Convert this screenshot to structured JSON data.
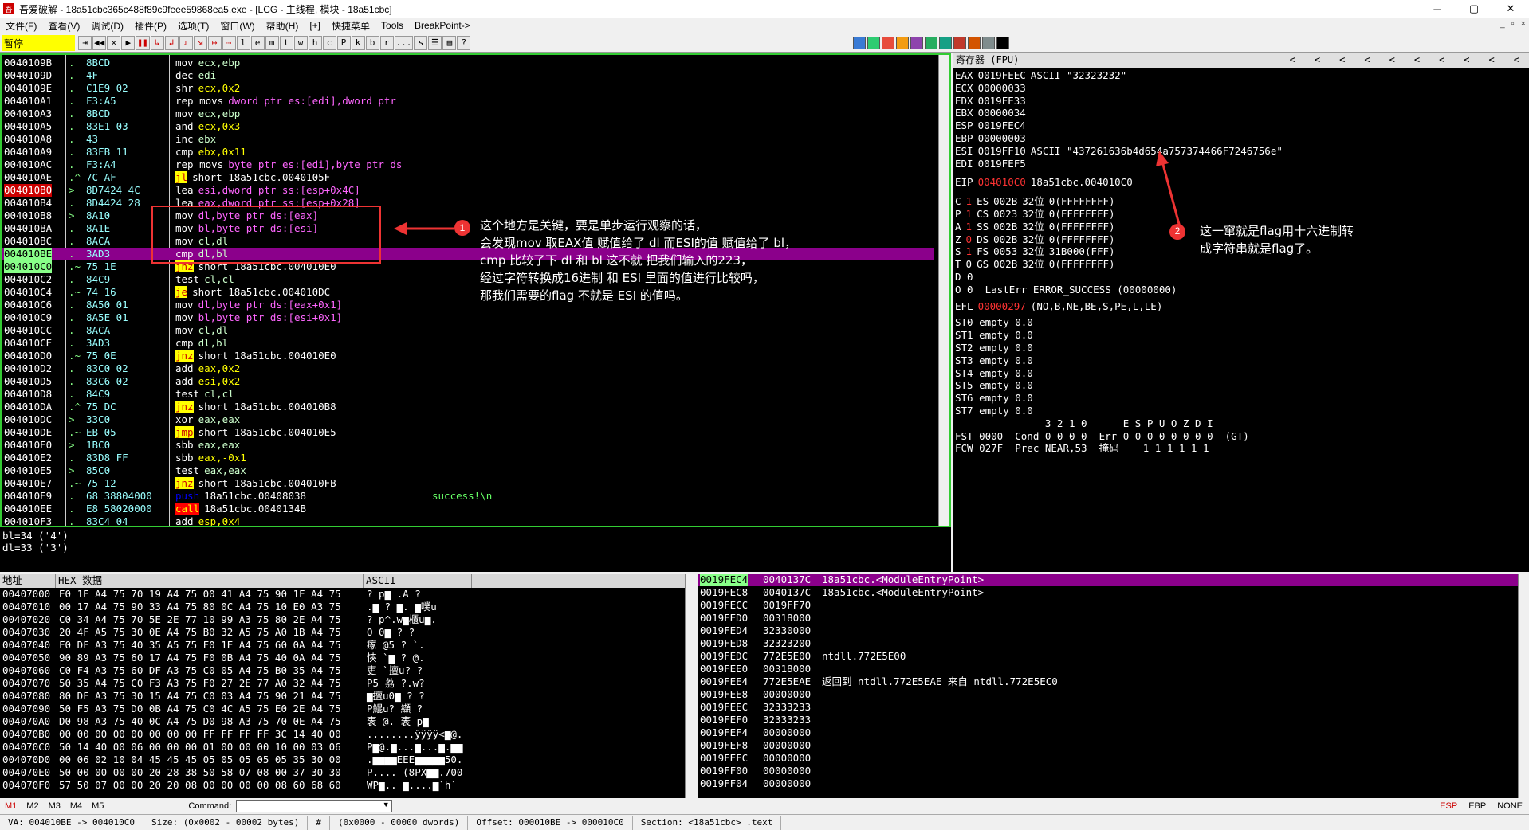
{
  "title": {
    "icon": "吾",
    "text": "吾爱破解 - 18a51cbc365c488f89c9feee59868ea5.exe - [LCG - 主线程, 模块 - 18a51cbc]",
    "min": "─",
    "max": "▢",
    "close": "✕"
  },
  "menu": [
    "文件(F)",
    "查看(V)",
    "调试(D)",
    "插件(P)",
    "选项(T)",
    "窗口(W)",
    "帮助(H)",
    "[+]",
    "快捷菜单",
    "Tools",
    "BreakPoint->"
  ],
  "mdi": [
    "_",
    "▫",
    "×"
  ],
  "toolbar": {
    "status": "暂停",
    "buttons": [
      "⇥",
      "◀◀",
      "✕",
      "▶",
      "❚❚",
      "↳",
      "↲",
      "⇓",
      "⇲",
      "↦",
      "⇢",
      "l",
      "e",
      "m",
      "t",
      "w",
      "h",
      "c",
      "P",
      "k",
      "b",
      "r",
      "...",
      "s",
      "☰",
      "▤",
      "?"
    ],
    "colors": [
      "#3a7bd5",
      "#2ecc71",
      "#e74c3c",
      "#f39c12",
      "#8e44ad",
      "#27ae60",
      "#16a085",
      "#c0392b",
      "#d35400",
      "#7f8c8d",
      "#000000"
    ]
  },
  "cpu": {
    "rows": [
      {
        "addr": "0040109B",
        "mark": ".",
        "hex": "8BCD",
        "mn": "mov",
        "ops": "ecx,ebp",
        "com": ""
      },
      {
        "addr": "0040109D",
        "mark": ".",
        "hex": "4F",
        "mn": "dec",
        "ops": "edi",
        "com": ""
      },
      {
        "addr": "0040109E",
        "mark": ".",
        "hex": "C1E9 02",
        "mn": "shr",
        "ops": "ecx,0x2",
        "com": ""
      },
      {
        "addr": "004010A1",
        "mark": ".",
        "hex": "F3:A5",
        "mn": "rep movs",
        "ops": "dword ptr es:[edi],dword ptr",
        "com": ""
      },
      {
        "addr": "004010A3",
        "mark": ".",
        "hex": "8BCD",
        "mn": "mov",
        "ops": "ecx,ebp",
        "com": ""
      },
      {
        "addr": "004010A5",
        "mark": ".",
        "hex": "83E1 03",
        "mn": "and",
        "ops": "ecx,0x3",
        "com": ""
      },
      {
        "addr": "004010A8",
        "mark": ".",
        "hex": "43",
        "mn": "inc",
        "ops": "ebx",
        "com": ""
      },
      {
        "addr": "004010A9",
        "mark": ".",
        "hex": "83FB 11",
        "mn": "cmp",
        "ops": "ebx,0x11",
        "com": ""
      },
      {
        "addr": "004010AC",
        "mark": ".",
        "hex": "F3:A4",
        "mn": "rep movs",
        "ops": "byte ptr es:[edi],byte ptr ds",
        "com": ""
      },
      {
        "addr": "004010AE",
        "mark": ".^",
        "hex": "7C AF",
        "mn": "jl",
        "ops": "short 18a51cbc.0040105F",
        "com": ""
      },
      {
        "addr": "004010B0",
        "mark": ">",
        "hex": "8D7424 4C",
        "mn": "lea",
        "ops": "esi,dword ptr ss:[esp+0x4C]",
        "com": ""
      },
      {
        "addr": "004010B4",
        "mark": ".",
        "hex": "8D4424 28",
        "mn": "lea",
        "ops": "eax,dword ptr ss:[esp+0x28]",
        "com": ""
      },
      {
        "addr": "004010B8",
        "mark": ">",
        "hex": "8A10",
        "mn": "mov",
        "ops": "dl,byte ptr ds:[eax]",
        "com": ""
      },
      {
        "addr": "004010BA",
        "mark": ".",
        "hex": "8A1E",
        "mn": "mov",
        "ops": "bl,byte ptr ds:[esi]",
        "com": ""
      },
      {
        "addr": "004010BC",
        "mark": ".",
        "hex": "8ACA",
        "mn": "mov",
        "ops": "cl,dl",
        "com": ""
      },
      {
        "addr": "004010BE",
        "mark": ".",
        "hex": "3AD3",
        "mn": "cmp",
        "ops": "dl,bl",
        "com": ""
      },
      {
        "addr": "004010C0",
        "mark": ".~",
        "hex": "75 1E",
        "mn": "jnz",
        "ops": "short 18a51cbc.004010E0",
        "com": ""
      },
      {
        "addr": "004010C2",
        "mark": ".",
        "hex": "84C9",
        "mn": "test",
        "ops": "cl,cl",
        "com": ""
      },
      {
        "addr": "004010C4",
        "mark": ".~",
        "hex": "74 16",
        "mn": "je",
        "ops": "short 18a51cbc.004010DC",
        "com": ""
      },
      {
        "addr": "004010C6",
        "mark": ".",
        "hex": "8A50 01",
        "mn": "mov",
        "ops": "dl,byte ptr ds:[eax+0x1]",
        "com": ""
      },
      {
        "addr": "004010C9",
        "mark": ".",
        "hex": "8A5E 01",
        "mn": "mov",
        "ops": "bl,byte ptr ds:[esi+0x1]",
        "com": ""
      },
      {
        "addr": "004010CC",
        "mark": ".",
        "hex": "8ACA",
        "mn": "mov",
        "ops": "cl,dl",
        "com": ""
      },
      {
        "addr": "004010CE",
        "mark": ".",
        "hex": "3AD3",
        "mn": "cmp",
        "ops": "dl,bl",
        "com": ""
      },
      {
        "addr": "004010D0",
        "mark": ".~",
        "hex": "75 0E",
        "mn": "jnz",
        "ops": "short 18a51cbc.004010E0",
        "com": ""
      },
      {
        "addr": "004010D2",
        "mark": ".",
        "hex": "83C0 02",
        "mn": "add",
        "ops": "eax,0x2",
        "com": ""
      },
      {
        "addr": "004010D5",
        "mark": ".",
        "hex": "83C6 02",
        "mn": "add",
        "ops": "esi,0x2",
        "com": ""
      },
      {
        "addr": "004010D8",
        "mark": ".",
        "hex": "84C9",
        "mn": "test",
        "ops": "cl,cl",
        "com": ""
      },
      {
        "addr": "004010DA",
        "mark": ".^",
        "hex": "75 DC",
        "mn": "jnz",
        "ops": "short 18a51cbc.004010B8",
        "com": ""
      },
      {
        "addr": "004010DC",
        "mark": ">",
        "hex": "33C0",
        "mn": "xor",
        "ops": "eax,eax",
        "com": ""
      },
      {
        "addr": "004010DE",
        "mark": ".~",
        "hex": "EB 05",
        "mn": "jmp",
        "ops": "short 18a51cbc.004010E5",
        "com": ""
      },
      {
        "addr": "004010E0",
        "mark": ">",
        "hex": "1BC0",
        "mn": "sbb",
        "ops": "eax,eax",
        "com": ""
      },
      {
        "addr": "004010E2",
        "mark": ".",
        "hex": "83D8 FF",
        "mn": "sbb",
        "ops": "eax,-0x1",
        "com": ""
      },
      {
        "addr": "004010E5",
        "mark": ">",
        "hex": "85C0",
        "mn": "test",
        "ops": "eax,eax",
        "com": ""
      },
      {
        "addr": "004010E7",
        "mark": ".~",
        "hex": "75 12",
        "mn": "jnz",
        "ops": "short 18a51cbc.004010FB",
        "com": ""
      },
      {
        "addr": "004010E9",
        "mark": ".",
        "hex": "68 38804000",
        "mn": "push",
        "ops": "18a51cbc.00408038",
        "com": "success!\\n"
      },
      {
        "addr": "004010EE",
        "mark": ".",
        "hex": "E8 58020000",
        "mn": "call",
        "ops": "18a51cbc.0040134B",
        "com": ""
      },
      {
        "addr": "004010F3",
        "mark": ".",
        "hex": "83C4 04",
        "mn": "add",
        "ops": "esp,0x4",
        "com": ""
      }
    ],
    "info": [
      "bl=34 ('4')",
      "dl=33 ('3')"
    ]
  },
  "registers": {
    "title": "寄存器 (FPU)",
    "arrows": [
      "<",
      "<",
      "<",
      "<",
      "<",
      "<",
      "<",
      "<",
      "<",
      "<"
    ],
    "gp": [
      [
        "EAX",
        "0019FEEC",
        "ASCII \"32323232\""
      ],
      [
        "ECX",
        "00000033",
        ""
      ],
      [
        "EDX",
        "0019FE33",
        ""
      ],
      [
        "EBX",
        "00000034",
        ""
      ],
      [
        "ESP",
        "0019FEC4",
        ""
      ],
      [
        "EBP",
        "00000003",
        ""
      ],
      [
        "ESI",
        "0019FF10",
        "ASCII \"437261636b4d654a757374466F7246756e\""
      ],
      [
        "EDI",
        "0019FEF5",
        ""
      ]
    ],
    "eip": [
      "EIP",
      "004010C0",
      "18a51cbc.004010C0"
    ],
    "seg": [
      [
        "C",
        "1",
        "ES",
        "002B",
        "32位",
        "0(FFFFFFFF)"
      ],
      [
        "P",
        "1",
        "CS",
        "0023",
        "32位",
        "0(FFFFFFFF)"
      ],
      [
        "A",
        "1",
        "SS",
        "002B",
        "32位",
        "0(FFFFFFFF)"
      ],
      [
        "Z",
        "0",
        "DS",
        "002B",
        "32位",
        "0(FFFFFFFF)"
      ],
      [
        "S",
        "1",
        "FS",
        "0053",
        "32位",
        "31B000(FFF)"
      ],
      [
        "T",
        "0",
        "GS",
        "002B",
        "32位",
        "0(FFFFFFFF)"
      ]
    ],
    "d": "D 0",
    "o": "O 0  LastErr ERROR_SUCCESS (00000000)",
    "efl": [
      "EFL",
      "00000297",
      "(NO,B,NE,BE,S,PE,L,LE)"
    ],
    "st": [
      "ST0 empty 0.0",
      "ST1 empty 0.0",
      "ST2 empty 0.0",
      "ST3 empty 0.0",
      "ST4 empty 0.0",
      "ST5 empty 0.0",
      "ST6 empty 0.0",
      "ST7 empty 0.0"
    ],
    "fhead": "               3 2 1 0      E S P U O Z D I",
    "fst": "FST 0000  Cond 0 0 0 0  Err 0 0 0 0 0 0 0 0  (GT)",
    "fcw": "FCW 027F  Prec NEAR,53  掩码    1 1 1 1 1 1"
  },
  "dump": {
    "headers": [
      "地址",
      "HEX 数据",
      "ASCII"
    ],
    "rows": [
      [
        "00407000",
        "E0 1E A4 75 70 19 A4 75 00 41 A4 75 90 1F A4 75",
        "? p▆ .A  ?"
      ],
      [
        "00407010",
        "00 17 A4 75 90 33 A4 75 80 0C A4 75 10 E0 A3 75",
        ".▆ ? ▆. ▆噗u"
      ],
      [
        "00407020",
        "C0 34 A4 75 70 5E 2E 77 10 99 A3 75 80 2E A4 75",
        "? p^.w▆櫃u▆."
      ],
      [
        "00407030",
        "20 4F A5 75 30 0E A4 75 B0 32 A5 75 A0 1B A4 75",
        " O  0▆  ?  ?"
      ],
      [
        "00407040",
        "F0 DF A3 75 40 35 A5 75 F0 1E A4 75 60 0A A4 75",
        "瘃 @5  ?  `."
      ],
      [
        "00407050",
        "90 89 A3 75 60 17 A4 75 F0 0B A4 75 40 0A A4 75",
        "悏 `▆  ?  @."
      ],
      [
        "00407060",
        "C0 F4 A3 75 60 DF A3 75 C0 05 A4 75 B0 35 A4 75",
        "吏 `擅u? ?"
      ],
      [
        "00407070",
        "50 35 A4 75 C0 F3 A3 75 F0 27 2E 77 A0 32 A4 75",
        "P5  荔  ?.w?"
      ],
      [
        "00407080",
        "80 DF A3 75 30 15 A4 75 C0 03 A4 75 90 21 A4 75",
        "▆擅u0▆  ?  ?"
      ],
      [
        "00407090",
        "50 F5 A3 75 D0 0B A4 75 C0 4C A5 75 E0 2E A4 75",
        "P鯤u? 纈  ?"
      ],
      [
        "004070A0",
        "D0 98 A3 75 40 0C A4 75 D0 98 A3 75 70 0E A4 75",
        "袠 @.  袠  p▆"
      ],
      [
        "004070B0",
        "00 00 00 00 00 00 00 00 FF FF FF FF 3C 14 40 00",
        "........ÿÿÿÿ<▆@."
      ],
      [
        "004070C0",
        "50 14 40 00 06 00 00 00 01 00 00 00 10 00 03 06",
        "P▆@.▆...▆...▆.▆▆"
      ],
      [
        "004070D0",
        "00 06 02 10 04 45 45 45 05 05 05 05 05 35 30 00",
        ".▆▆▆▆EEE▆▆▆▆▆50."
      ],
      [
        "004070E0",
        "50 00 00 00 00 20 28 38 50 58 07 08 00 37 30 30",
        "P.... (8PX▆▆.700"
      ],
      [
        "004070F0",
        "57 50 07 00 00 20 20 08 00 00 00 00 08 60 68 60",
        "WP▆..  ▆....▆`h`"
      ]
    ]
  },
  "stack": {
    "rows": [
      [
        "0019FEC4",
        "0040137C",
        "18a51cbc.<ModuleEntryPoint>"
      ],
      [
        "0019FEC8",
        "0040137C",
        "18a51cbc.<ModuleEntryPoint>"
      ],
      [
        "0019FECC",
        "0019FF70",
        ""
      ],
      [
        "0019FED0",
        "00318000",
        ""
      ],
      [
        "0019FED4",
        "32330000",
        ""
      ],
      [
        "0019FED8",
        "32323200",
        ""
      ],
      [
        "0019FEDC",
        "772E5E00",
        "ntdll.772E5E00"
      ],
      [
        "0019FEE0",
        "00318000",
        ""
      ],
      [
        "0019FEE4",
        "772E5EAE",
        "返回到 ntdll.772E5EAE 来自 ntdll.772E5EC0"
      ],
      [
        "0019FEE8",
        "00000000",
        ""
      ],
      [
        "0019FEEC",
        "32333233",
        ""
      ],
      [
        "0019FEF0",
        "32333233",
        ""
      ],
      [
        "0019FEF4",
        "00000000",
        ""
      ],
      [
        "0019FEF8",
        "00000000",
        ""
      ],
      [
        "0019FEFC",
        "00000000",
        ""
      ],
      [
        "0019FF00",
        "00000000",
        ""
      ],
      [
        "0019FF04",
        "00000000",
        ""
      ]
    ]
  },
  "cmdbar": {
    "tabs": [
      "M1",
      "M2",
      "M3",
      "M4",
      "M5"
    ],
    "label": "Command:",
    "value": "",
    "regs": [
      "ESP",
      "EBP",
      "NONE"
    ]
  },
  "statusbar": [
    "VA: 004010BE -> 004010C0",
    "Size: (0x0002 - 00002 bytes)",
    "#",
    "(0x0000 - 00000 dwords)",
    "Offset: 000010BE -> 000010C0",
    "Section: <18a51cbc> .text"
  ],
  "annotations": {
    "n1": "1",
    "n2": "2",
    "a1": [
      "这个地方是关键，要是单步运行观察的话，",
      "会发现mov 取EAX值 赋值给了 dl 而ESI的值 赋值给了 bl，",
      "cmp 比较了下 dl 和 bl 这不就 把我们输入的223，",
      "经过字符转换成16进制 和 ESI 里面的值进行比较吗，",
      "那我们需要的flag 不就是 ESI 的值吗。"
    ],
    "a2": [
      "这一窜就是flag用十六进制转",
      "成字符串就是flag了。"
    ]
  }
}
